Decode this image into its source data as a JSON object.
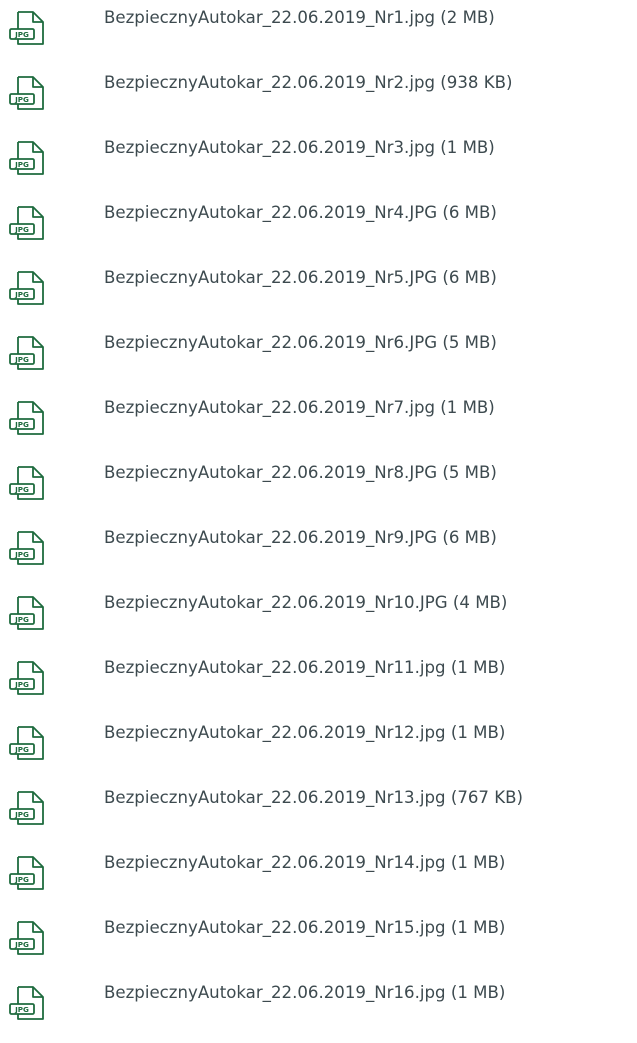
{
  "icon": {
    "name": "jpg-file-icon",
    "label": "JPG",
    "color": "#1e6b3e"
  },
  "files": [
    {
      "text": "BezpiecznyAutokar_22.06.2019_Nr1.jpg (2 MB)"
    },
    {
      "text": "BezpiecznyAutokar_22.06.2019_Nr2.jpg (938 KB)"
    },
    {
      "text": "BezpiecznyAutokar_22.06.2019_Nr3.jpg (1 MB)"
    },
    {
      "text": "BezpiecznyAutokar_22.06.2019_Nr4.JPG (6 MB)"
    },
    {
      "text": "BezpiecznyAutokar_22.06.2019_Nr5.JPG (6 MB)"
    },
    {
      "text": "BezpiecznyAutokar_22.06.2019_Nr6.JPG (5 MB)"
    },
    {
      "text": "BezpiecznyAutokar_22.06.2019_Nr7.jpg (1 MB)"
    },
    {
      "text": "BezpiecznyAutokar_22.06.2019_Nr8.JPG (5 MB)"
    },
    {
      "text": "BezpiecznyAutokar_22.06.2019_Nr9.JPG (6 MB)"
    },
    {
      "text": "BezpiecznyAutokar_22.06.2019_Nr10.JPG (4 MB)"
    },
    {
      "text": "BezpiecznyAutokar_22.06.2019_Nr11.jpg (1 MB)"
    },
    {
      "text": "BezpiecznyAutokar_22.06.2019_Nr12.jpg (1 MB)"
    },
    {
      "text": "BezpiecznyAutokar_22.06.2019_Nr13.jpg (767 KB)"
    },
    {
      "text": "BezpiecznyAutokar_22.06.2019_Nr14.jpg (1 MB)"
    },
    {
      "text": "BezpiecznyAutokar_22.06.2019_Nr15.jpg (1 MB)"
    },
    {
      "text": "BezpiecznyAutokar_22.06.2019_Nr16.jpg (1 MB)"
    }
  ]
}
